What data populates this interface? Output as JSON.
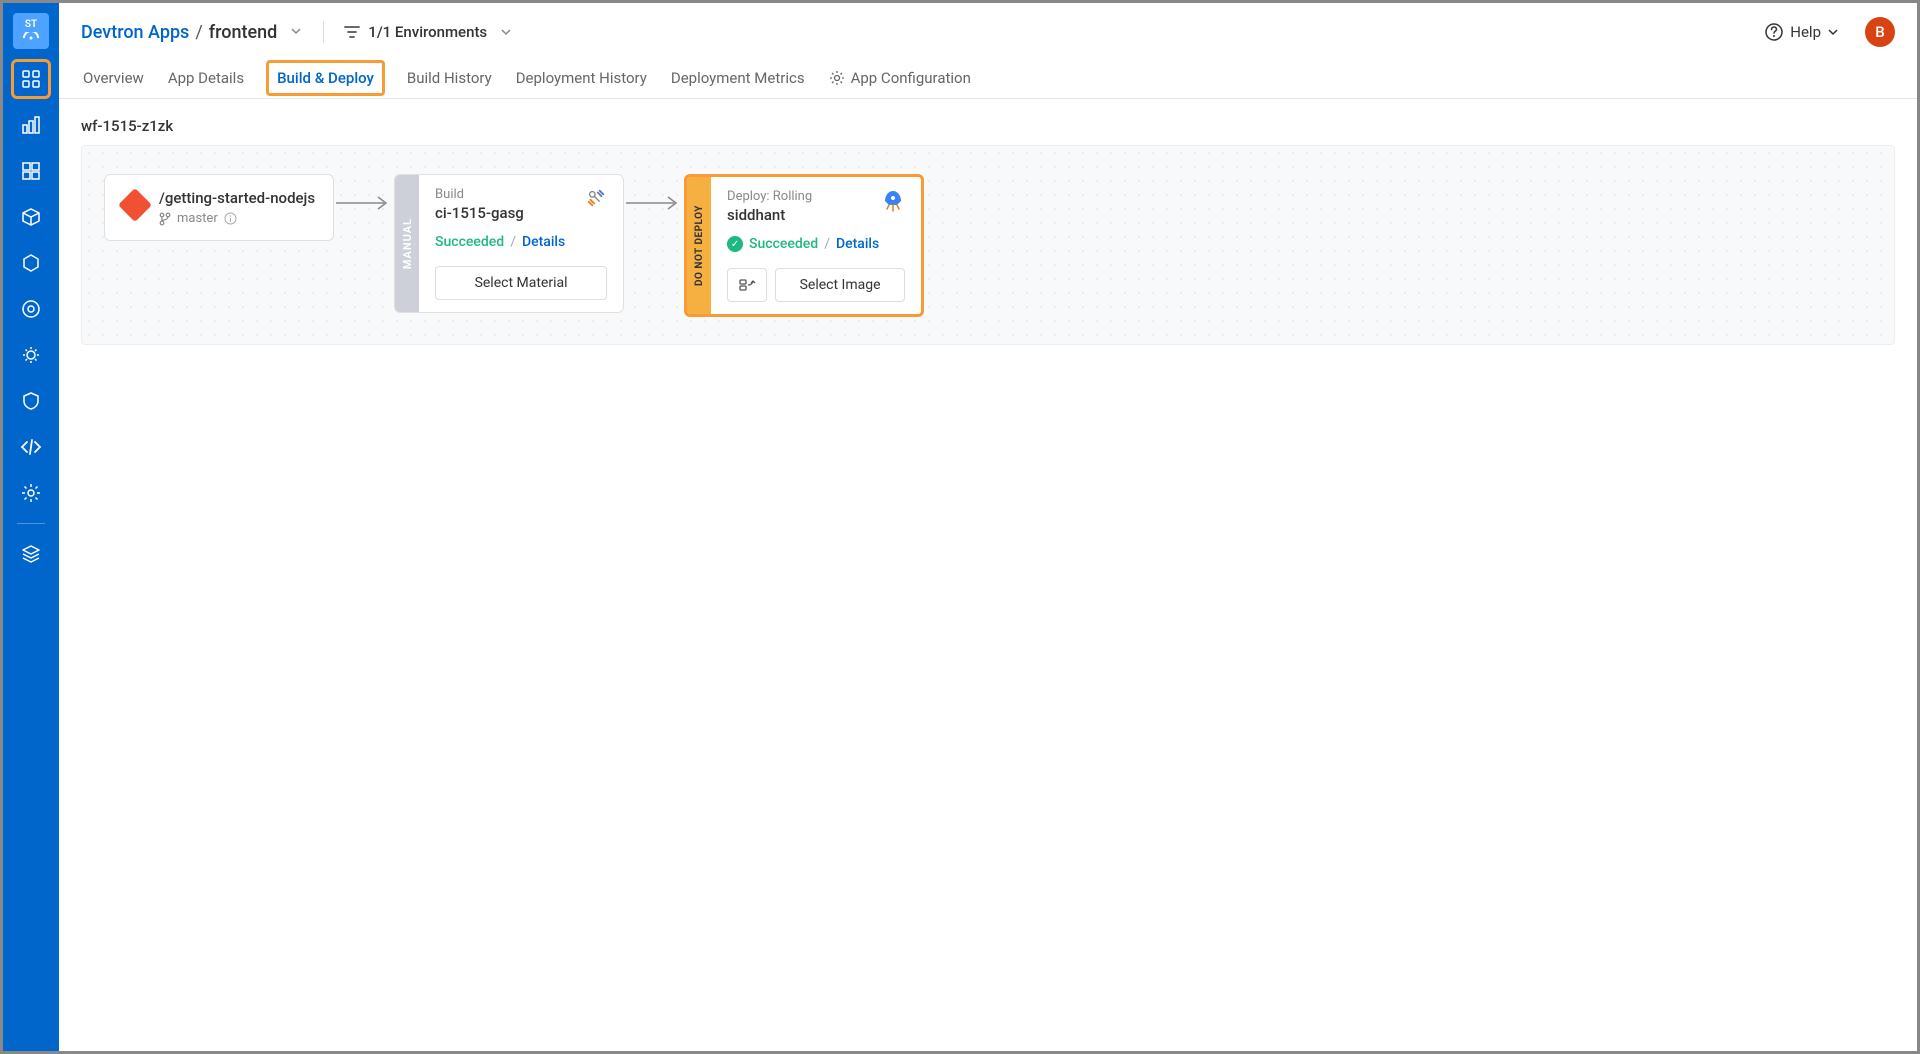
{
  "sidebar": {
    "logo_text": "ST"
  },
  "header": {
    "breadcrumb_parent": "Devtron Apps",
    "breadcrumb_current": "frontend",
    "env_filter": "1/1 Environments",
    "help_label": "Help",
    "avatar_letter": "B"
  },
  "tabs": {
    "overview": "Overview",
    "app_details": "App Details",
    "build_deploy": "Build & Deploy",
    "build_history": "Build History",
    "deployment_history": "Deployment History",
    "deployment_metrics": "Deployment Metrics",
    "app_configuration": "App Configuration"
  },
  "workflow": {
    "name": "wf-1515-z1zk",
    "source": {
      "repo": "/getting-started-nodejs",
      "branch": "master"
    },
    "build": {
      "sidebar_label": "MANUAL",
      "label": "Build",
      "id": "ci-1515-gasg",
      "status": "Succeeded",
      "details_label": "Details",
      "select_label": "Select Material"
    },
    "deploy": {
      "sidebar_label": "DO NOT DEPLOY",
      "label": "Deploy: Rolling",
      "env": "siddhant",
      "status": "Succeeded",
      "details_label": "Details",
      "select_label": "Select Image"
    }
  }
}
